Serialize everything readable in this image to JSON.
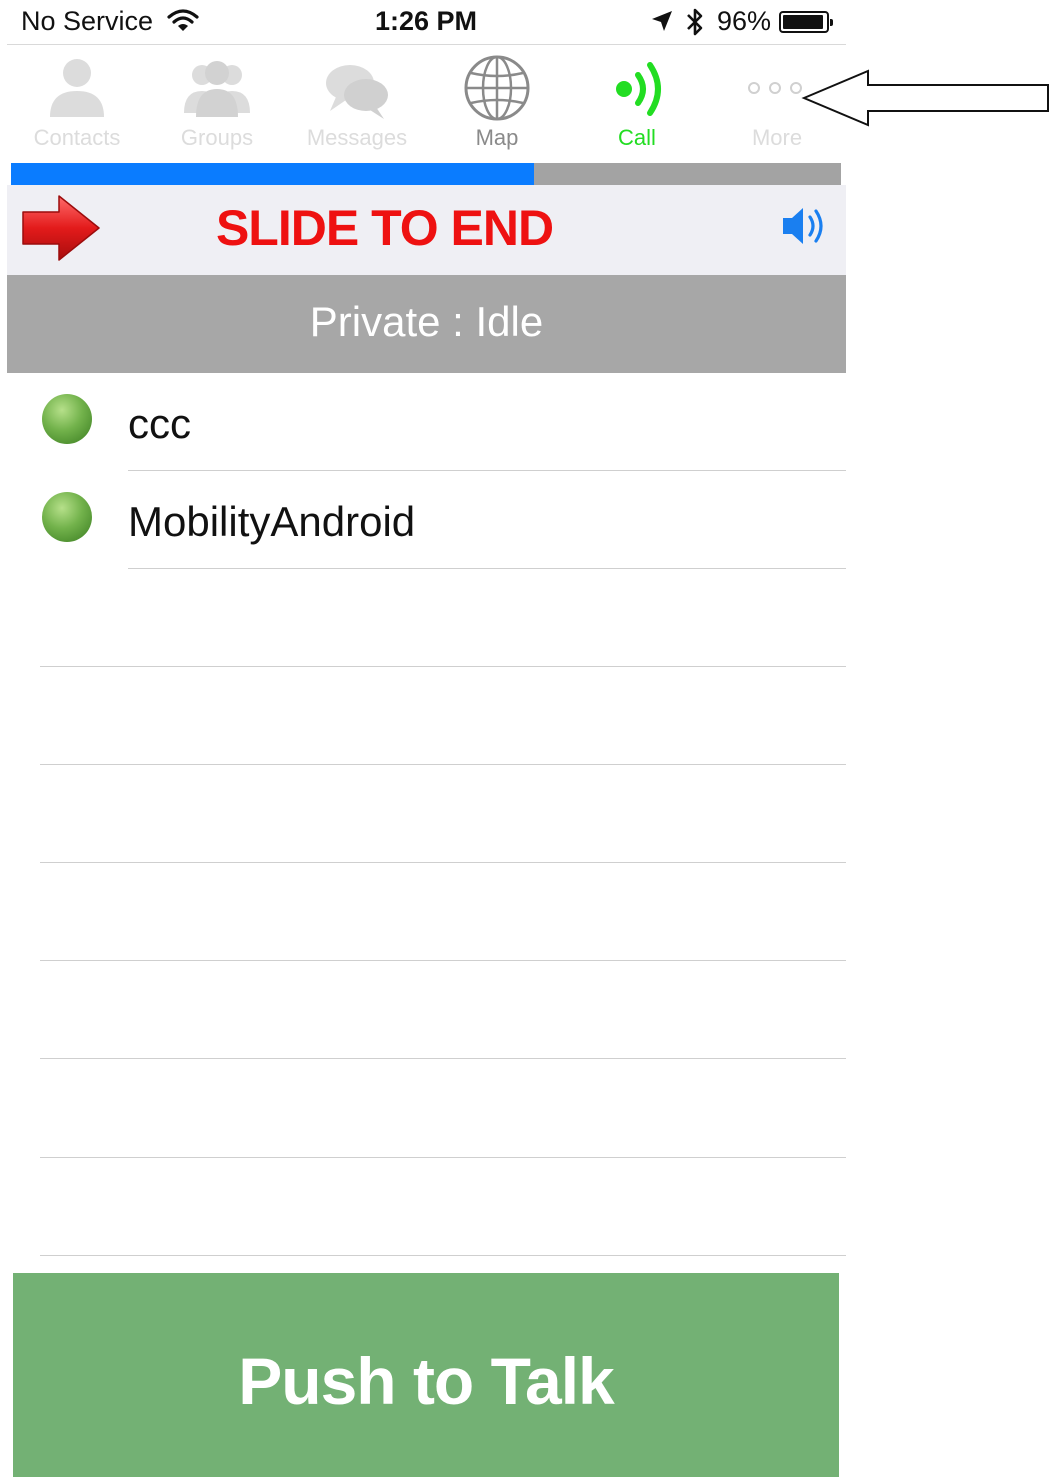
{
  "status_bar": {
    "carrier": "No Service",
    "time": "1:26 PM",
    "battery_percent": "96%",
    "battery_level": 0.96,
    "icons": [
      "wifi-icon",
      "location-arrow-icon",
      "bluetooth-icon",
      "battery-icon"
    ]
  },
  "tabs": [
    {
      "label": "Contacts",
      "icon": "contacts-icon",
      "state": "disabled"
    },
    {
      "label": "Groups",
      "icon": "groups-icon",
      "state": "disabled"
    },
    {
      "label": "Messages",
      "icon": "messages-icon",
      "state": "disabled"
    },
    {
      "label": "Map",
      "icon": "globe-icon",
      "state": "normal"
    },
    {
      "label": "Call",
      "icon": "call-signal-icon",
      "state": "selected"
    },
    {
      "label": "More",
      "icon": "more-dots-icon",
      "state": "disabled"
    }
  ],
  "progress": {
    "value": 0.63,
    "fill_color": "#0a7cff",
    "track_color": "#a3a3a3"
  },
  "slide_bar": {
    "label": "SLIDE TO END",
    "color": "#ee1111",
    "icons": [
      "red-arrow-icon",
      "speaker-icon"
    ]
  },
  "call_status": {
    "text": "Private : Idle"
  },
  "members": [
    {
      "name": "ccc",
      "presence": "online"
    },
    {
      "name": "MobilityAndroid",
      "presence": "online"
    }
  ],
  "push_to_talk": {
    "label": "Push to Talk",
    "color": "#73b174"
  },
  "annotation": {
    "icon": "callout-arrow-icon",
    "points_to": "More"
  }
}
